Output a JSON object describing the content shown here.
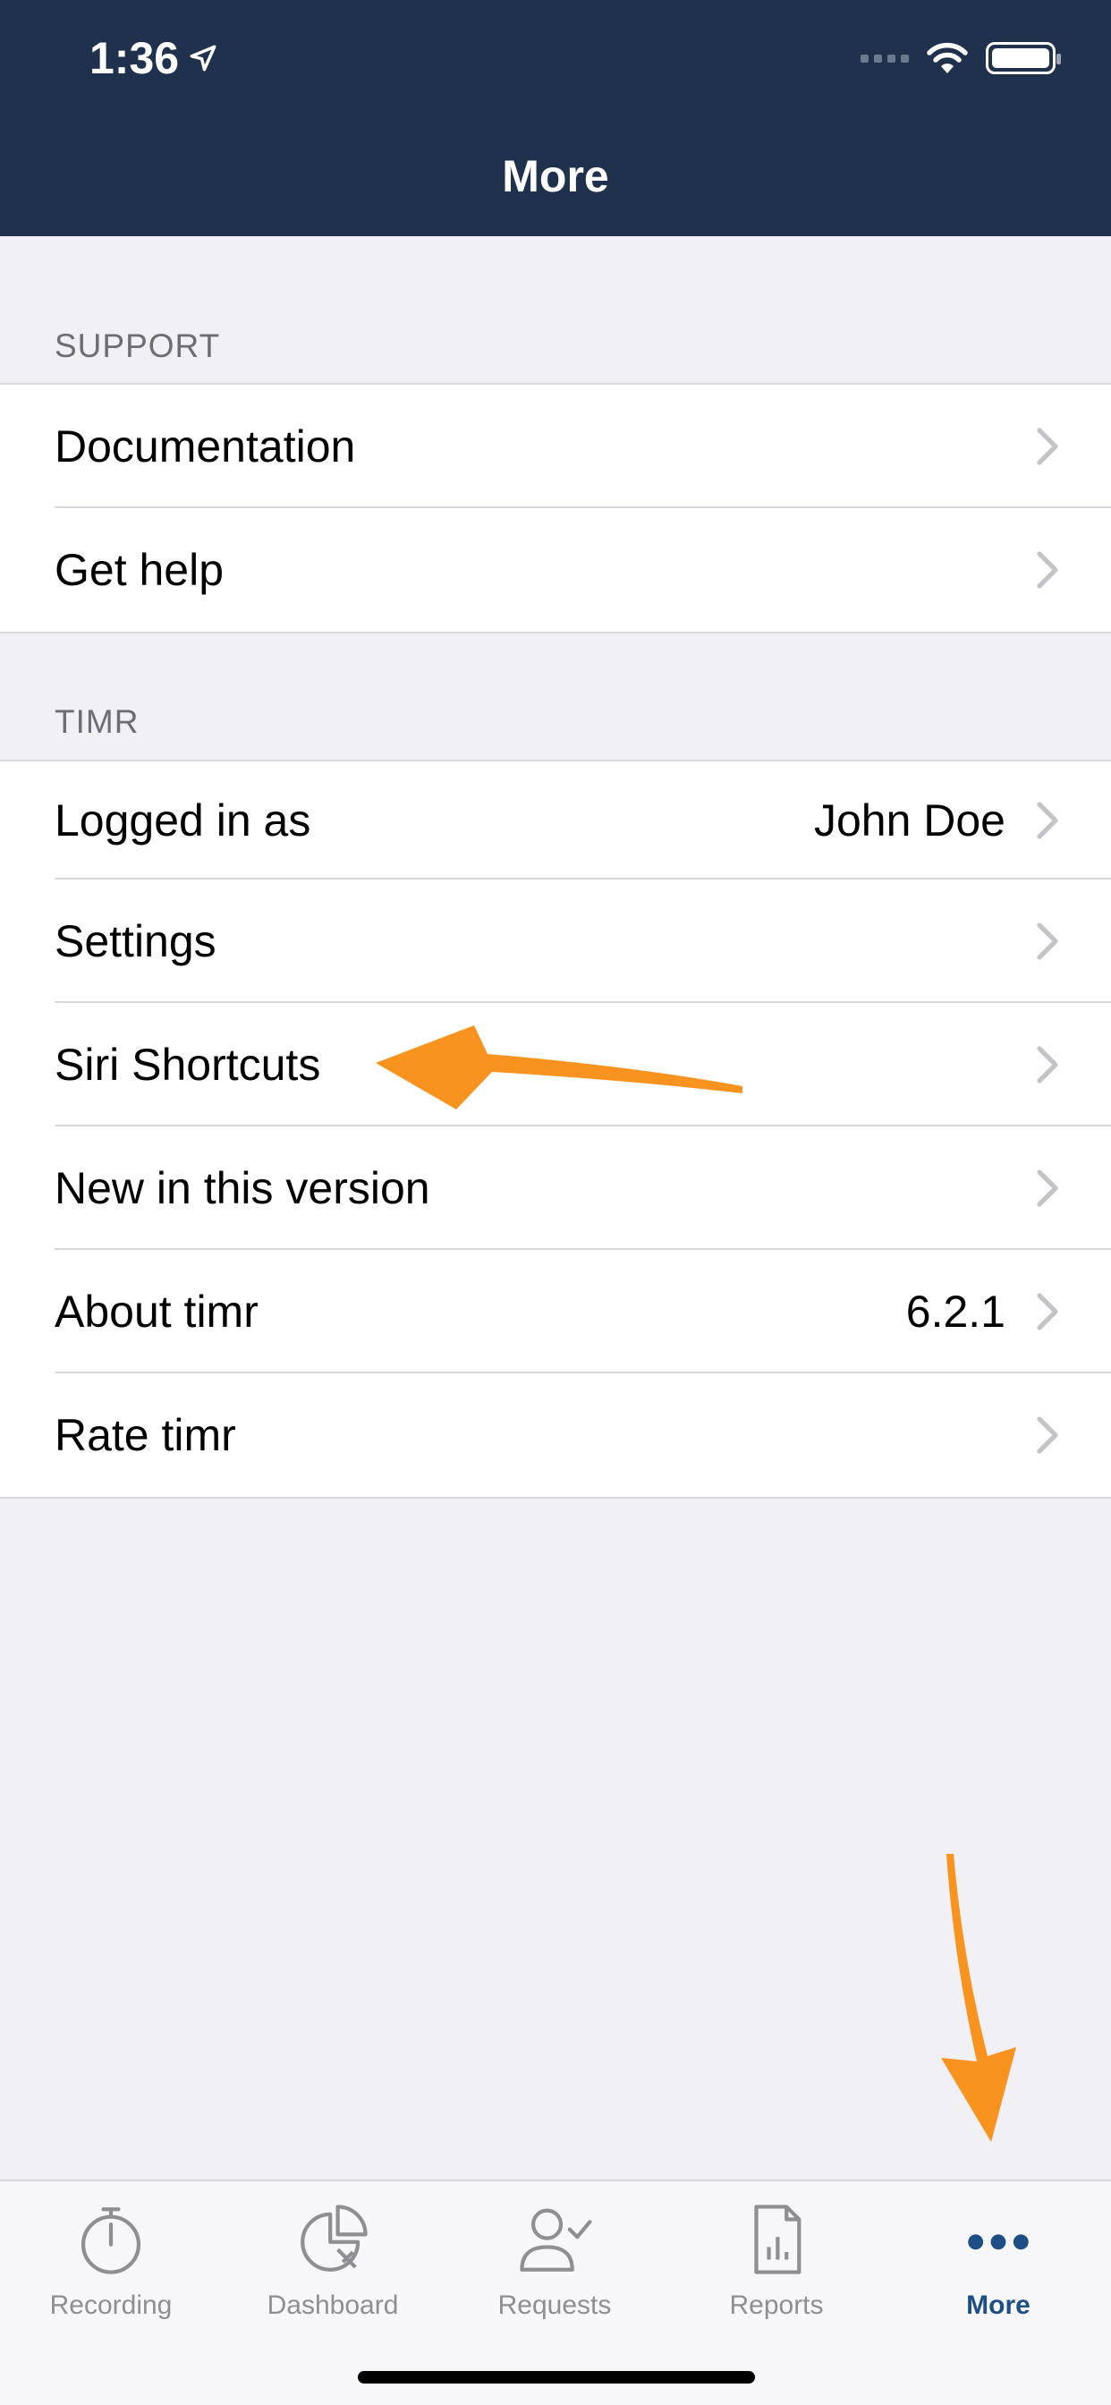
{
  "status_bar": {
    "time": "1:36"
  },
  "nav": {
    "title": "More"
  },
  "support": {
    "header": "SUPPORT",
    "rows": [
      {
        "label": "Documentation"
      },
      {
        "label": "Get help"
      }
    ]
  },
  "timr": {
    "header": "TIMR",
    "rows": [
      {
        "label": "Logged in as",
        "value": "John Doe"
      },
      {
        "label": "Settings"
      },
      {
        "label": "Siri Shortcuts"
      },
      {
        "label": "New in this version"
      },
      {
        "label": "About timr",
        "value": "6.2.1"
      },
      {
        "label": "Rate timr"
      }
    ]
  },
  "tabs": [
    {
      "label": "Recording",
      "icon": "stopwatch-icon"
    },
    {
      "label": "Dashboard",
      "icon": "pie-chart-icon"
    },
    {
      "label": "Requests",
      "icon": "person-check-icon"
    },
    {
      "label": "Reports",
      "icon": "report-document-icon"
    },
    {
      "label": "More",
      "icon": "more-dots-icon",
      "active": true
    }
  ],
  "colors": {
    "header_bg": "#1f314d",
    "accent": "#1d4f86",
    "annotation_arrow": "#f7931e",
    "background": "#f0f0f5"
  }
}
